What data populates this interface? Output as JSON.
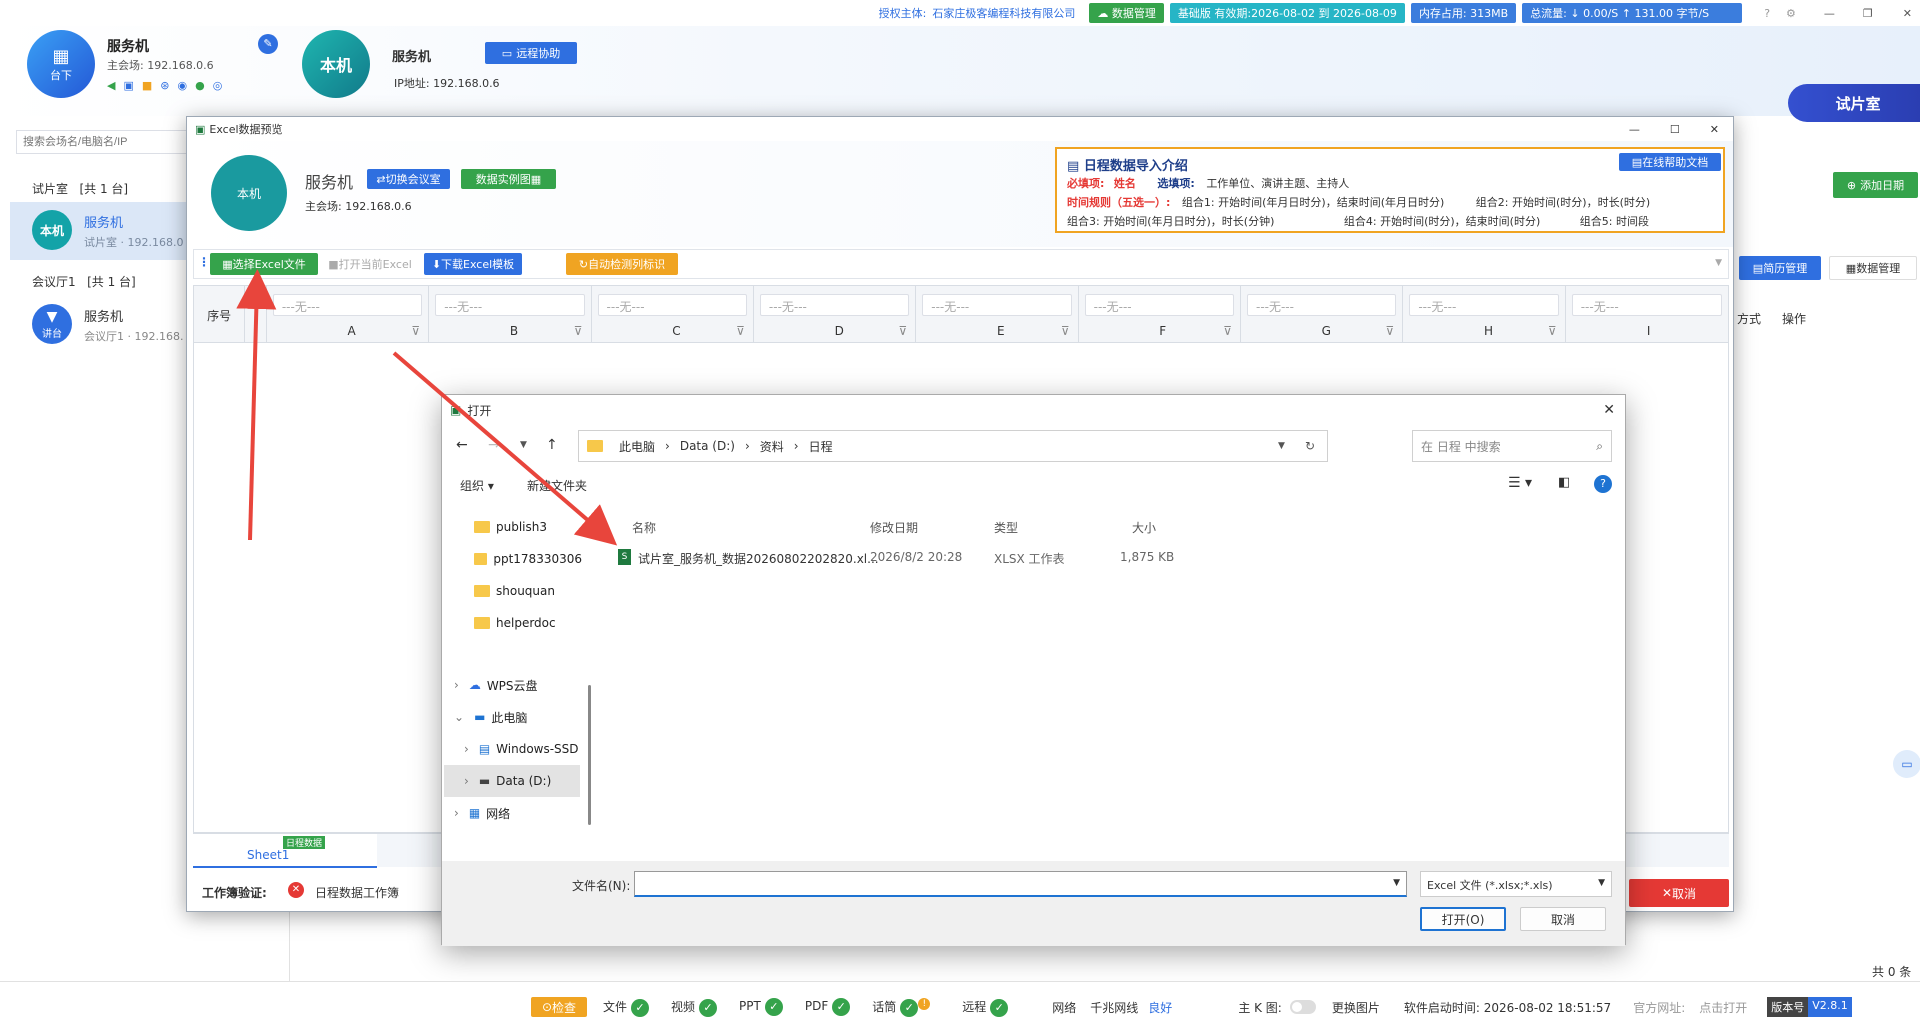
{
  "topbar": {
    "license_label": "授权主体:",
    "license_company": "石家庄极客编程科技有限公司",
    "data_mgmt": "数据管理",
    "validity": "基础版 有效期:2026-08-02 到 2026-08-09",
    "memory": "内存占用: 313MB",
    "traffic": "总流量: ↓ 0.00/S  ↑ 131.00 字节/S"
  },
  "header": {
    "main_avatar_label": "台下",
    "main_name": "服务机",
    "main_ip": "主会场: 192.168.0.6",
    "local_avatar": "本机",
    "local_name": "服务机",
    "remote_assist": "远程协助",
    "ip_label": "IP地址: 192.168.0.6",
    "room_button": "试片室"
  },
  "sidebar": {
    "search_placeholder": "搜索会场名/电脑名/IP",
    "groups": [
      {
        "title": "试片室",
        "count": "[共 1 台]",
        "device": {
          "avatar": "本机",
          "name": "服务机",
          "sub": "试片室 · 192.168.0"
        }
      },
      {
        "title": "会议厅1",
        "count": "[共 1 台]",
        "device": {
          "avatar": "讲台",
          "name": "服务机",
          "sub": "会议厅1 · 192.168."
        }
      }
    ]
  },
  "right_panel": {
    "add_schedule": "添加日期",
    "mode_col": "方式",
    "op_col": "操作",
    "total": "共 0 条",
    "brief_mgmt": "简历管理",
    "data_mgmt": "数据管理"
  },
  "excel_modal": {
    "title": "Excel数据预览",
    "avatar": "本机",
    "name": "服务机",
    "switch_room": "切换会议室",
    "sample_data": "数据实例图",
    "ip": "主会场: 192.168.0.6",
    "intro": {
      "title": "日程数据导入介绍",
      "help": "在线帮助文档",
      "required_label": "必填项:",
      "required_value": "姓名",
      "optional_label": "选填项:",
      "optional_value": "工作单位、演讲主题、主持人",
      "rule_label": "时间规则（五选一）:",
      "combo1": "组合1:  开始时间(年月日时分)，结束时间(年月日时分)",
      "combo2": "组合2:  开始时间(时分)，时长(时分)",
      "combo3": "组合3:  开始时间(年月日时分)，时长(分钟)",
      "combo4": "组合4:  开始时间(时分)，结束时间(时分)",
      "combo5": "组合5:  时间段"
    },
    "toolbar": {
      "select_file": "选择Excel文件",
      "open_current": "打开当前Excel",
      "download_template": "下载Excel模板",
      "auto_detect": "自动检测列标识"
    },
    "grid": {
      "seq": "序号",
      "placeholder": "---无---",
      "columns": [
        "A",
        "B",
        "C",
        "D",
        "E",
        "F",
        "G",
        "H",
        "I"
      ]
    },
    "sheet_tab": "Sheet1",
    "sheet_badge": "日程数据",
    "verify_label": "工作簿验证:",
    "verify_text": "日程数据工作簿",
    "cancel": "取消"
  },
  "open_dialog": {
    "title": "打开",
    "breadcrumb": [
      "此电脑",
      "Data (D:)",
      "资料",
      "日程"
    ],
    "search_placeholder": "在 日程 中搜索",
    "organize": "组织",
    "new_folder": "新建文件夹",
    "tree": [
      "publish3",
      "ppt178330306",
      "shouquan",
      "helperdoc",
      "WPS云盘",
      "此电脑",
      "Windows-SSD",
      "Data (D:)",
      "网络"
    ],
    "headers": [
      "名称",
      "修改日期",
      "类型",
      "大小"
    ],
    "file": {
      "name": "试片室_服务机_数据20260802202820.xl...",
      "date": "2026/8/2 20:28",
      "type": "XLSX 工作表",
      "size": "1,875 KB"
    },
    "filename_label": "文件名(N):",
    "filter": "Excel 文件 (*.xlsx;*.xls)",
    "open_btn": "打开(O)",
    "cancel_btn": "取消"
  },
  "statusbar": {
    "check": "检查",
    "items": [
      "文件",
      "视频",
      "PPT",
      "PDF",
      "话筒",
      "远程"
    ],
    "network": "网络",
    "net_type": "千兆网线",
    "net_status": "良好",
    "main_k": "主 K 图:",
    "change_img": "更换图片",
    "start_time": "软件启动时间: 2026-08-02 18:51:57",
    "website": "官方网址:",
    "click_open": "点击打开",
    "version_label": "版本号",
    "version": "V2.8.1"
  },
  "colors": {
    "primary": "#2f6fe0",
    "green": "#35a34b",
    "orange": "#f0a422",
    "red": "#e53935"
  }
}
